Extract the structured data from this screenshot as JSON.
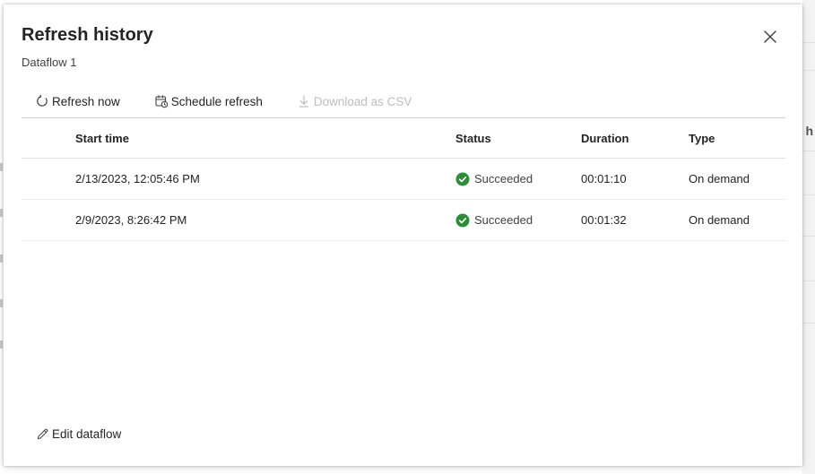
{
  "background": {
    "right_fragment": "h"
  },
  "dialog": {
    "title": "Refresh history",
    "subtitle": "Dataflow 1",
    "close_icon": "close-icon"
  },
  "toolbar": {
    "refresh_now": {
      "label": "Refresh now",
      "icon": "refresh-icon"
    },
    "schedule_refresh": {
      "label": "Schedule refresh",
      "icon": "calendar-clock-icon"
    },
    "download_csv": {
      "label": "Download as CSV",
      "icon": "download-icon",
      "disabled": true
    }
  },
  "table": {
    "columns": [
      "Start time",
      "Status",
      "Duration",
      "Type"
    ],
    "rows": [
      {
        "start_time": "2/13/2023, 12:05:46 PM",
        "status": "Succeeded",
        "duration": "00:01:10",
        "type": "On demand"
      },
      {
        "start_time": "2/9/2023, 8:26:42 PM",
        "status": "Succeeded",
        "duration": "00:01:32",
        "type": "On demand"
      }
    ]
  },
  "footer": {
    "edit_dataflow": {
      "label": "Edit dataflow",
      "icon": "pencil-icon"
    }
  },
  "colors": {
    "success": "#2e8b3a",
    "disabled_text": "#bdbdbd",
    "text": "#242424"
  }
}
